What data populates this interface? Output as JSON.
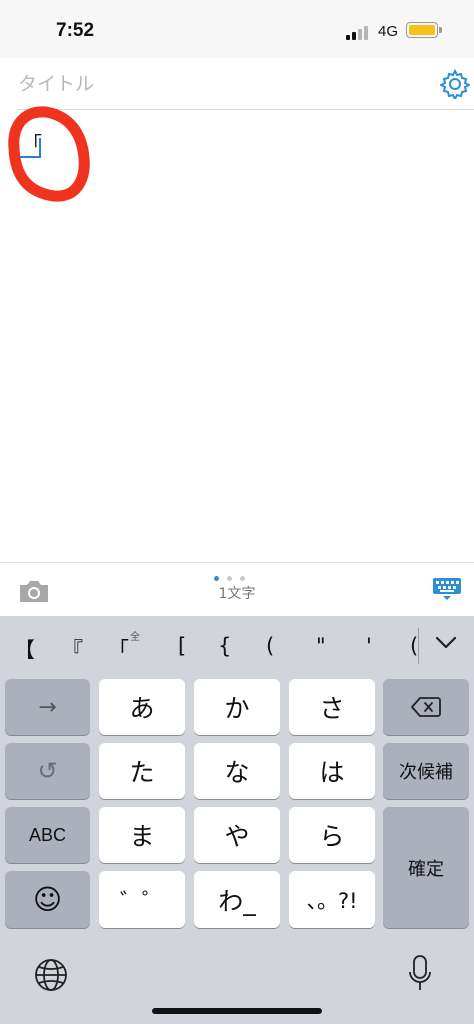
{
  "status_bar": {
    "time": "7:52",
    "network": "4G",
    "battery_color": "#f6c21a",
    "signal_active_color": "#111111",
    "signal_inactive_color": "#b5b5b5"
  },
  "editor": {
    "title_placeholder": "タイトル",
    "body_text": "「",
    "settings_icon": "gear-icon",
    "accent": "#2c8fd6",
    "annotation_color": "#f0331f"
  },
  "toolbar": {
    "char_count": "1文字",
    "camera_icon": "camera-icon",
    "keyboard_icon": "keyboard-icon",
    "page_dots": 3,
    "page_active": 0
  },
  "keyboard": {
    "candidates": [
      "【",
      "『",
      "「",
      "全",
      "[",
      "{",
      "(",
      "\"",
      "'",
      "("
    ],
    "rows": [
      [
        "→",
        "あ",
        "か",
        "さ",
        "⌫"
      ],
      [
        "↺",
        "た",
        "な",
        "は",
        "次候補"
      ],
      [
        "ABC",
        "ま",
        "や",
        "ら",
        "確定"
      ],
      [
        "☺",
        "゛゜",
        "わ_",
        "、。?!"
      ]
    ],
    "globe_icon": "globe-icon",
    "mic_icon": "microphone-icon",
    "background": "#d1d4db"
  }
}
